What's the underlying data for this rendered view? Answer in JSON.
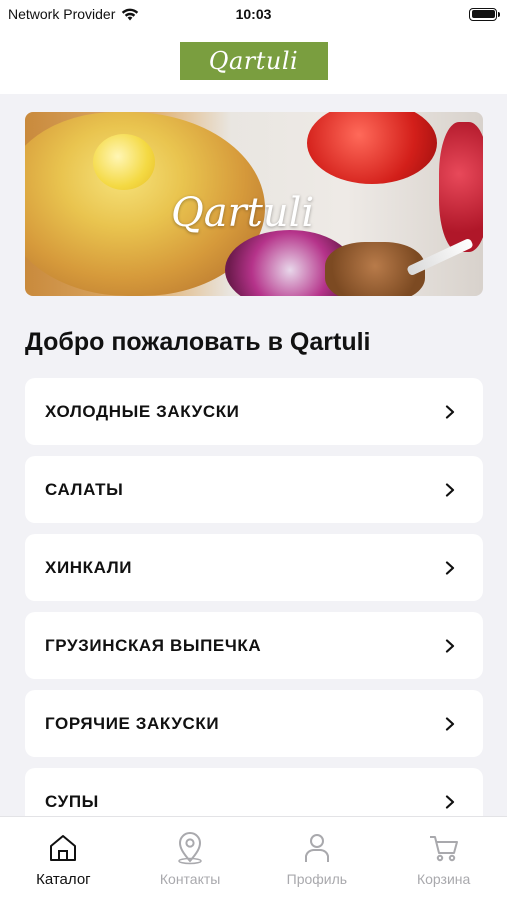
{
  "status_bar": {
    "carrier": "Network Provider",
    "time": "10:03"
  },
  "header": {
    "logo_text": "Qartuli"
  },
  "banner": {
    "logo_text": "Qartuli"
  },
  "welcome_title": "Добро пожаловать в Qartuli",
  "categories": [
    {
      "label": "ХОЛОДНЫЕ ЗАКУСКИ"
    },
    {
      "label": "САЛАТЫ"
    },
    {
      "label": "ХИНКАЛИ"
    },
    {
      "label": "ГРУЗИНСКАЯ ВЫПЕЧКА"
    },
    {
      "label": "ГОРЯЧИЕ ЗАКУСКИ"
    },
    {
      "label": "СУПЫ"
    }
  ],
  "tabs": [
    {
      "label": "Каталог",
      "icon": "home-icon",
      "active": true
    },
    {
      "label": "Контакты",
      "icon": "map-pin-icon",
      "active": false
    },
    {
      "label": "Профиль",
      "icon": "person-icon",
      "active": false
    },
    {
      "label": "Корзина",
      "icon": "cart-icon",
      "active": false
    }
  ],
  "colors": {
    "logo_bg": "#7a9e3f",
    "background": "#f2f2f6",
    "inactive_tab": "#a9a9ad"
  }
}
